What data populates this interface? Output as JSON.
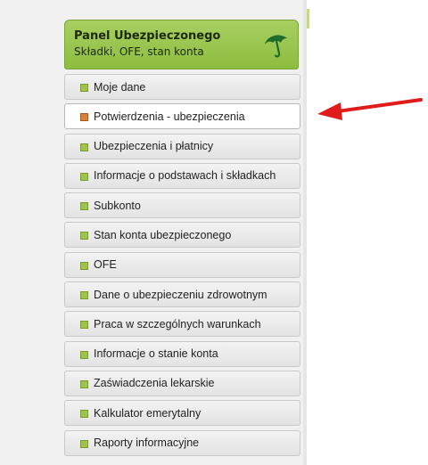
{
  "panel": {
    "title": "Panel Ubezpieczonego",
    "subtitle": "Składki, OFE, stan konta",
    "icon": "umbrella-icon"
  },
  "menu": {
    "items": [
      {
        "label": "Moje dane",
        "active": false
      },
      {
        "label": "Potwierdzenia - ubezpieczenia",
        "active": true
      },
      {
        "label": "Ubezpieczenia i płatnicy",
        "active": false
      },
      {
        "label": "Informacje o podstawach i składkach",
        "active": false
      },
      {
        "label": "Subkonto",
        "active": false
      },
      {
        "label": "Stan konta ubezpieczonego",
        "active": false
      },
      {
        "label": "OFE",
        "active": false
      },
      {
        "label": "Dane o ubezpieczeniu zdrowotnym",
        "active": false
      },
      {
        "label": "Praca w szczególnych warunkach",
        "active": false
      },
      {
        "label": "Informacje o stanie konta",
        "active": false
      },
      {
        "label": "Zaświadczenia lekarskie",
        "active": false
      },
      {
        "label": "Kalkulator emerytalny",
        "active": false
      },
      {
        "label": "Raporty informacyjne",
        "active": false
      }
    ]
  },
  "colors": {
    "header_green": "#9bc64f",
    "bullet_green": "#a0c24f",
    "bullet_active": "#d9823c",
    "arrow_red": "#e01b1b"
  }
}
